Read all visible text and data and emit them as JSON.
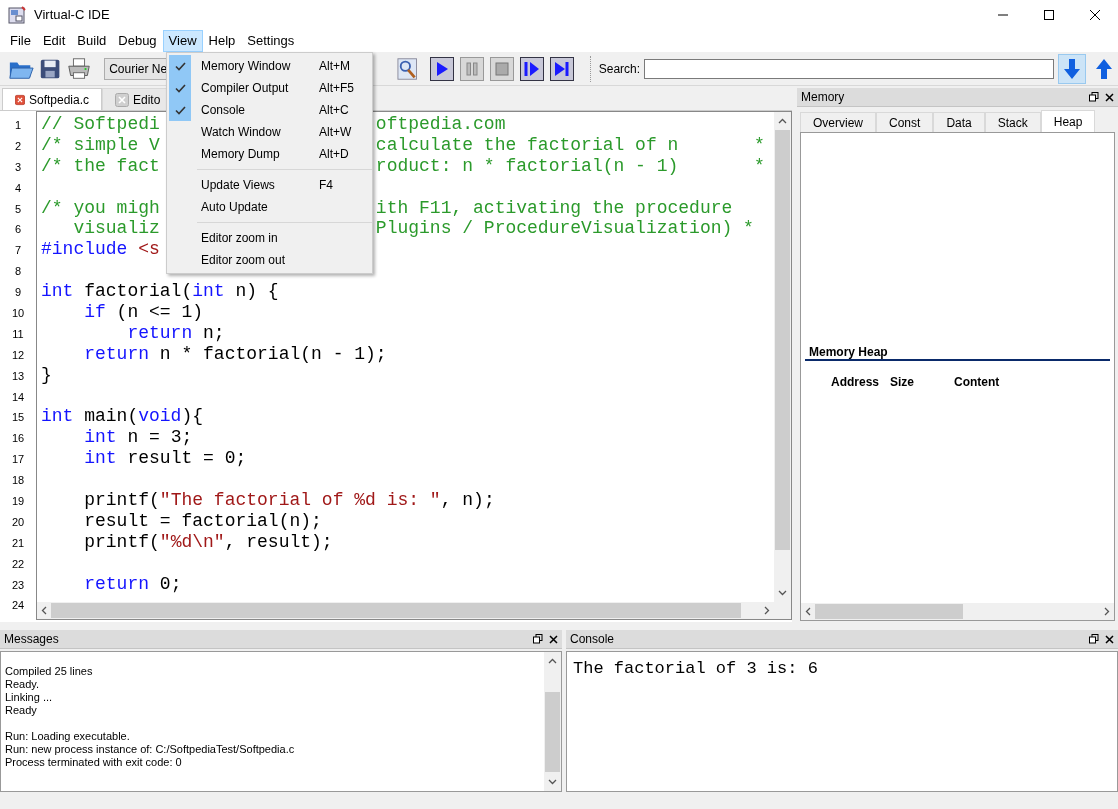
{
  "window": {
    "title": "Virtual-C IDE"
  },
  "menu_bar": [
    {
      "label": "File",
      "selected": false
    },
    {
      "label": "Edit",
      "selected": false
    },
    {
      "label": "Build",
      "selected": false
    },
    {
      "label": "Debug",
      "selected": false
    },
    {
      "label": "View",
      "selected": true
    },
    {
      "label": "Help",
      "selected": false
    },
    {
      "label": "Settings",
      "selected": false
    }
  ],
  "view_menu": {
    "groups": [
      [
        {
          "label": "Memory Window",
          "shortcut": "Alt+M",
          "checked": true
        },
        {
          "label": "Compiler Output",
          "shortcut": "Alt+F5",
          "checked": true
        },
        {
          "label": "Console",
          "shortcut": "Alt+C",
          "checked": true
        },
        {
          "label": "Watch Window",
          "shortcut": "Alt+W",
          "checked": false
        },
        {
          "label": "Memory Dump",
          "shortcut": "Alt+D",
          "checked": false
        }
      ],
      [
        {
          "label": "Update Views",
          "shortcut": "F4",
          "checked": false
        },
        {
          "label": "Auto Update",
          "checked": false
        }
      ],
      [
        {
          "label": "Editor zoom in",
          "checked": false
        },
        {
          "label": "Editor zoom out",
          "checked": false
        }
      ]
    ]
  },
  "toolbar": {
    "font_combo": "Courier Ne",
    "search_label": "Search:",
    "search_down_selected": true
  },
  "editor_tabs": [
    {
      "label": "Softpedia.c",
      "selected": true
    },
    {
      "label": "Edito",
      "selected": false
    }
  ],
  "code_lines": [
    {
      "number": "1",
      "left": [
        {
          "kind": "comment",
          "text": "// Softpedi"
        }
      ],
      "right": [
        {
          "kind": "comment",
          "text": "oftpedia.com"
        }
      ]
    },
    {
      "number": "2",
      "left": [
        {
          "kind": "comment",
          "text": "/* simple V"
        }
      ],
      "right": [
        {
          "kind": "comment",
          "text": "calculate the factorial of n       *"
        }
      ]
    },
    {
      "number": "3",
      "left": [
        {
          "kind": "comment",
          "text": "/* the fact"
        }
      ],
      "right": [
        {
          "kind": "comment",
          "text": "roduct: n * factorial(n - 1)       *"
        }
      ]
    },
    {
      "number": "4"
    },
    {
      "number": "5",
      "left": [
        {
          "kind": "comment",
          "text": "/* you migh"
        }
      ],
      "right": [
        {
          "kind": "comment",
          "text": "ith F11, activating the procedure"
        }
      ]
    },
    {
      "number": "6",
      "left": [
        {
          "kind": "comment",
          "text": "   visualiz"
        }
      ],
      "right": [
        {
          "kind": "comment",
          "text": "Plugins / ProcedureVisualization) *"
        }
      ]
    },
    {
      "number": "7",
      "left": [
        {
          "kind": "keyword",
          "text": "#include"
        },
        {
          "kind": "string",
          "text": " <s"
        }
      ]
    },
    {
      "number": "8"
    },
    {
      "number": "9",
      "left": [
        {
          "kind": "keyword",
          "text": "int"
        },
        {
          "kind": "plain",
          "text": " factorial("
        },
        {
          "kind": "keyword",
          "text": "int"
        },
        {
          "kind": "plain",
          "text": " n) {"
        }
      ]
    },
    {
      "number": "10",
      "left": [
        {
          "kind": "keyword",
          "text": "    if"
        },
        {
          "kind": "plain",
          "text": " (n <= 1)"
        }
      ]
    },
    {
      "number": "11",
      "left": [
        {
          "kind": "keyword",
          "text": "        return"
        },
        {
          "kind": "plain",
          "text": " n;"
        }
      ]
    },
    {
      "number": "12",
      "left": [
        {
          "kind": "keyword",
          "text": "    return"
        },
        {
          "kind": "plain",
          "text": " n * factorial(n - 1);"
        }
      ]
    },
    {
      "number": "13",
      "left": [
        {
          "kind": "plain",
          "text": "}"
        }
      ]
    },
    {
      "number": "14"
    },
    {
      "number": "15",
      "left": [
        {
          "kind": "keyword",
          "text": "int"
        },
        {
          "kind": "plain",
          "text": " main("
        },
        {
          "kind": "keyword",
          "text": "void"
        },
        {
          "kind": "plain",
          "text": "){"
        }
      ]
    },
    {
      "number": "16",
      "left": [
        {
          "kind": "keyword",
          "text": "    int"
        },
        {
          "kind": "plain",
          "text": " n = 3;"
        }
      ]
    },
    {
      "number": "17",
      "left": [
        {
          "kind": "keyword",
          "text": "    int"
        },
        {
          "kind": "plain",
          "text": " result = 0;"
        }
      ]
    },
    {
      "number": "18"
    },
    {
      "number": "19",
      "left": [
        {
          "kind": "plain",
          "text": "    printf("
        },
        {
          "kind": "string",
          "text": "\"The factorial of %d is: \""
        },
        {
          "kind": "plain",
          "text": ", n);"
        }
      ]
    },
    {
      "number": "20",
      "left": [
        {
          "kind": "plain",
          "text": "    result = factorial(n);"
        }
      ]
    },
    {
      "number": "21",
      "left": [
        {
          "kind": "plain",
          "text": "    printf("
        },
        {
          "kind": "string",
          "text": "\"%d\\n\""
        },
        {
          "kind": "plain",
          "text": ", result);"
        }
      ]
    },
    {
      "number": "22"
    },
    {
      "number": "23",
      "left": [
        {
          "kind": "keyword",
          "text": "    return"
        },
        {
          "kind": "plain",
          "text": " 0;"
        }
      ]
    },
    {
      "number": "24"
    }
  ],
  "memory_panel": {
    "title": "Memory",
    "tabs": [
      {
        "label": "Overview",
        "selected": false
      },
      {
        "label": "Const",
        "selected": false
      },
      {
        "label": "Data",
        "selected": false
      },
      {
        "label": "Stack",
        "selected": false
      },
      {
        "label": "Heap",
        "selected": true
      }
    ],
    "heading": "Memory Heap",
    "columns": [
      "Address",
      "Size",
      "Content"
    ]
  },
  "messages_panel": {
    "title": "Messages",
    "groups": [
      [
        "Compiled 25 lines",
        "Ready.",
        "Linking ...",
        "Ready"
      ],
      [
        "Run: Loading executable.",
        "Run: new process instance of: C:/SoftpediaTest/Softpedia.c",
        "Process terminated with exit code: 0"
      ]
    ]
  },
  "console_panel": {
    "title": "Console",
    "output": "The factorial of 3 is: 6"
  }
}
